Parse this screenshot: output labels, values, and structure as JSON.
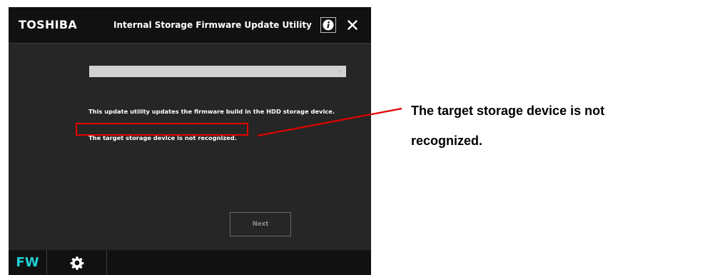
{
  "window": {
    "brand": "TOSHIBA",
    "title": "Internal Storage Firmware Update Utility",
    "info_icon": "info-icon",
    "close_icon": "close-icon"
  },
  "main": {
    "drive_select": {
      "value": ""
    },
    "description": "This update utility updates the firmware build in the HDD storage device.",
    "status": "The target storage device is not recognized.",
    "next_label": "Next"
  },
  "bottom_bar": {
    "fw_label": "FW",
    "settings_icon": "gear-icon"
  },
  "annotation": {
    "callout_line1": "The target storage device is not",
    "callout_line2": "recognized.",
    "highlight_color": "#e30000"
  },
  "colors": {
    "window_bg": "#262626",
    "bar_bg": "#111111",
    "accent": "#1fd1d6"
  }
}
